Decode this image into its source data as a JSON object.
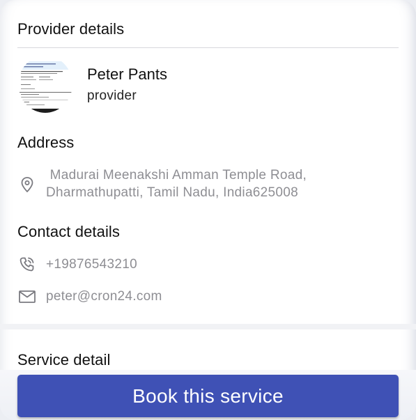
{
  "provider_section": {
    "title": "Provider details",
    "name": "Peter Pants",
    "role": "provider"
  },
  "address_section": {
    "title": "Address",
    "line1": " Madurai Meenakshi Amman Temple Road,",
    "line2": "Dharmathupatti, Tamil Nadu, India625008",
    "icon": "location-pin-icon"
  },
  "contact_section": {
    "title": "Contact details",
    "phone": "+19876543210",
    "phone_icon": "phone-icon",
    "email": "peter@cron24.com",
    "email_icon": "mail-icon"
  },
  "service_section": {
    "title": "Service detail"
  },
  "book_button": {
    "label": "Book this service"
  },
  "colors": {
    "accent": "#3f51b5",
    "muted_text": "#8e8e93",
    "heading_text": "#111111"
  }
}
